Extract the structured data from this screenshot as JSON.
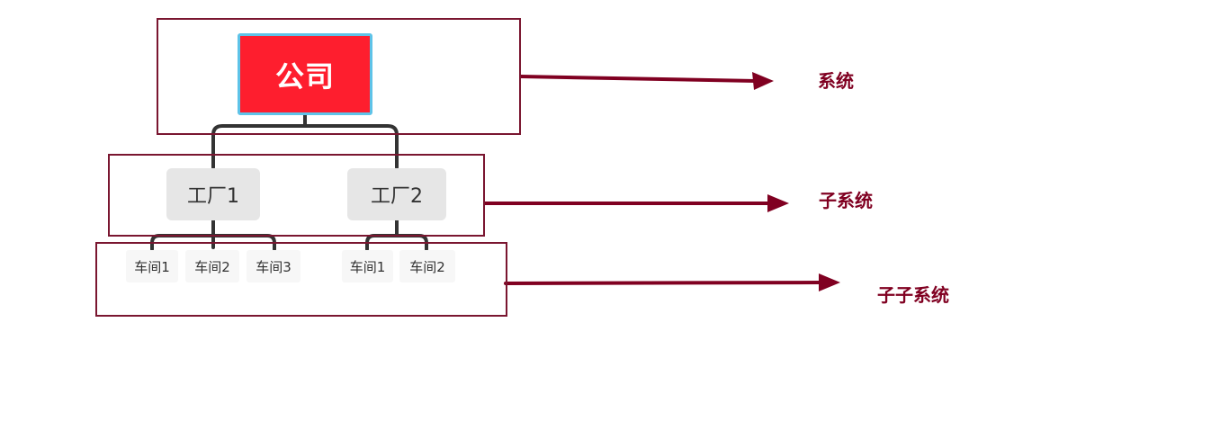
{
  "org_chart": {
    "root": {
      "label": "公司",
      "fill": "#fe1e2e",
      "border": "#5ec3e8"
    },
    "factories": [
      {
        "label": "工厂1",
        "workshops": [
          "车间1",
          "车间2",
          "车间3"
        ]
      },
      {
        "label": "工厂2",
        "workshops": [
          "车间1",
          "车间2"
        ]
      }
    ]
  },
  "levels": [
    {
      "label": "系统"
    },
    {
      "label": "子系统"
    },
    {
      "label": "子子系统"
    }
  ],
  "colors": {
    "frame": "#7a1630",
    "arrow": "#800021",
    "connector": "#333333",
    "node_fill": "#e6e6e6",
    "leaf_fill": "#f7f7f7"
  }
}
